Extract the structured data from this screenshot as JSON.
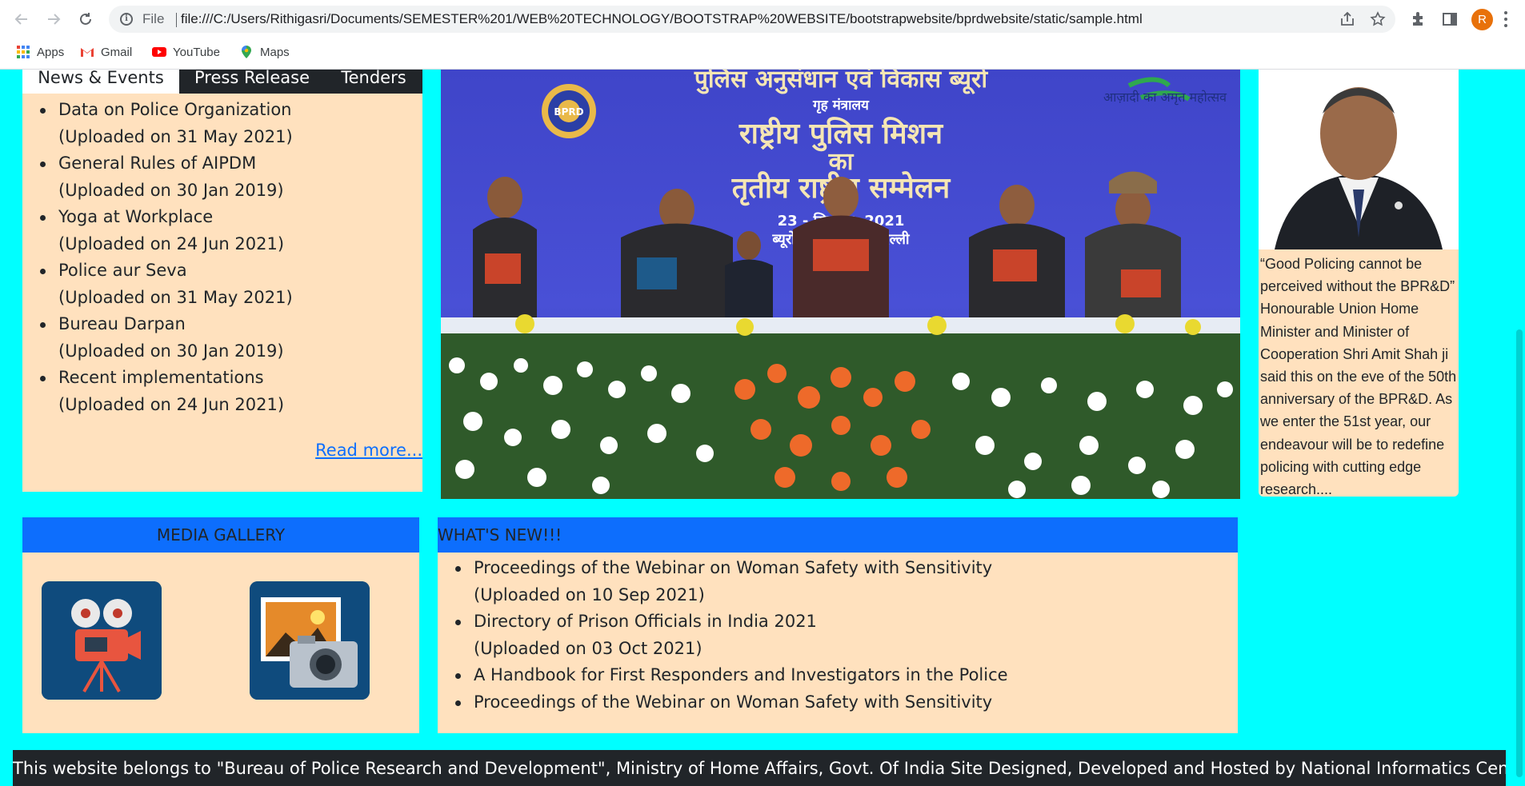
{
  "browser": {
    "scheme_label": "File",
    "url": "file:///C:/Users/Rithigasri/Documents/SEMESTER%201/WEB%20TECHNOLOGY/BOOTSTRAP%20WEBSITE/bootstrapwebsite/bprdwebsite/static/sample.html",
    "profile_initial": "R",
    "bookmarks": [
      {
        "label": "Apps",
        "icon": "apps-grid-icon"
      },
      {
        "label": "Gmail",
        "icon": "gmail-icon"
      },
      {
        "label": "YouTube",
        "icon": "youtube-icon"
      },
      {
        "label": "Maps",
        "icon": "maps-icon"
      }
    ]
  },
  "news": {
    "tabs": [
      "News & Events",
      "Press Release",
      "Tenders"
    ],
    "items": [
      {
        "title": "Data on Police Organization",
        "date": "(Uploaded on 31 May 2021)"
      },
      {
        "title": "General Rules of AIPDM",
        "date": "(Uploaded on 30 Jan 2019)"
      },
      {
        "title": "Yoga at Workplace",
        "date": "(Uploaded on 24 Jun 2021)"
      },
      {
        "title": "Police aur Seva",
        "date": "(Uploaded on 31 May 2021)"
      },
      {
        "title": "Bureau Darpan",
        "date": "(Uploaded on 30 Jan 2019)"
      },
      {
        "title": "Recent implementations",
        "date": "(Uploaded on 24 Jun 2021)"
      }
    ],
    "read_more": "Read more..."
  },
  "banner": {
    "line1": "पुलिस अनुसंधान एवं विकास ब्यूरो",
    "line2": "गृह मंत्रालय",
    "line3": "राष्ट्रीय पुलिस मिशन",
    "line4": "का",
    "line5": "तृतीय राष्ट्रीय सम्मेलन",
    "line6": "23 - सितम्बर, 2021",
    "line7": "ब्यूरो मुख्यालय, नई दिल्ली",
    "emblem_text": "BPRD",
    "azadi_text": "आज़ादी का अमृत महोत्सव"
  },
  "quote": {
    "text": "“Good Policing cannot be perceived without the BPR&D” Honourable Union Home Minister and Minister of Cooperation Shri Amit Shah ji said this on the eve of the 50th anniversary of the BPR&D. As we enter the 51st year, our endeavour will be to redefine policing with cutting edge research...."
  },
  "media": {
    "heading": "MEDIA GALLERY",
    "tiles": [
      {
        "label": "video-gallery",
        "icon": "video-camera-icon"
      },
      {
        "label": "photo-gallery",
        "icon": "photo-camera-icon"
      }
    ]
  },
  "whats_new": {
    "heading": "WHAT'S NEW!!!",
    "items": [
      {
        "title": "Proceedings of the Webinar on Woman Safety with Sensitivity",
        "date": "(Uploaded on 10 Sep 2021)"
      },
      {
        "title": "Directory of Prison Officials in India 2021",
        "date": "(Uploaded on 03 Oct 2021)"
      },
      {
        "title": "A Handbook for First Responders and Investigators in the Police",
        "date": ""
      },
      {
        "title": "Proceedings of the Webinar on Woman Safety with Sensitivity",
        "date": ""
      }
    ]
  },
  "footer": {
    "text": "This website belongs to \"Bureau of Police Research and Development\", Ministry of Home Affairs, Govt. Of India Site Designed, Developed and Hosted by National Informatics Centre"
  },
  "colors": {
    "page_background": "#00ffff",
    "panel_background": "#ffe1be",
    "header_blue": "#0d6efd",
    "dark": "#212529",
    "link": "#0d6efd"
  }
}
